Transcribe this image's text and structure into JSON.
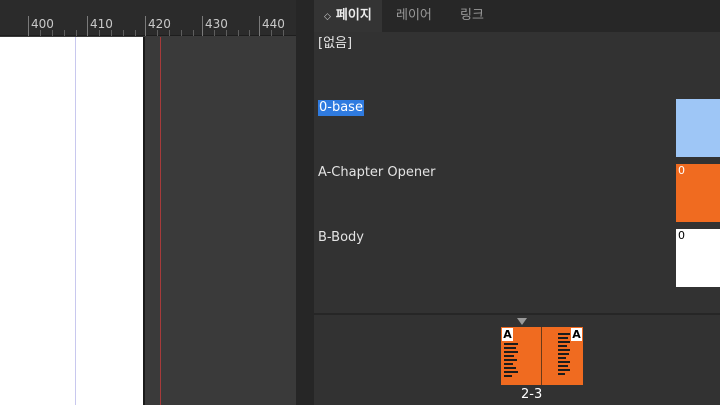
{
  "ruler": {
    "labels": [
      "400",
      "410",
      "420",
      "430",
      "440"
    ]
  },
  "tabs": [
    {
      "label": "페이지",
      "active": true
    },
    {
      "label": "레이어",
      "active": false
    },
    {
      "label": "링크",
      "active": false
    }
  ],
  "masters": {
    "none": "[없음]",
    "items": [
      {
        "label": "0-base",
        "selected": true,
        "thumb_prefix": ""
      },
      {
        "label": "A-Chapter Opener",
        "selected": false,
        "thumb_prefix": "0"
      },
      {
        "label": "B-Body",
        "selected": false,
        "thumb_prefix": "0"
      }
    ]
  },
  "spread": {
    "label": "2-3",
    "left_master": "A",
    "right_master": "A"
  },
  "colors": {
    "accent_selection": "#2f7be0",
    "master_0": "#9ec6f6",
    "master_A": "#f06b20",
    "master_B": "#ffffff"
  }
}
